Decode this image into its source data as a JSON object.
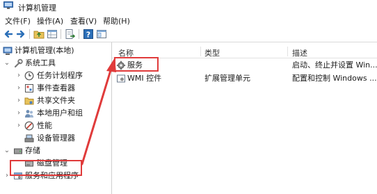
{
  "window": {
    "title": "计算机管理"
  },
  "menu": [
    "文件(F)",
    "操作(A)",
    "查看(V)",
    "帮助(H)"
  ],
  "toolbar": {
    "icons": [
      "back-arrow-icon",
      "forward-arrow-icon",
      "folder-up-icon",
      "properties-grid-icon",
      "export-list-icon",
      "help-icon",
      "console-tree-icon"
    ]
  },
  "tree": {
    "root": "计算机管理(本地)",
    "items": [
      {
        "label": "系统工具",
        "expanded": true
      },
      {
        "label": "任务计划程序"
      },
      {
        "label": "事件查看器"
      },
      {
        "label": "共享文件夹"
      },
      {
        "label": "本地用户和组"
      },
      {
        "label": "性能"
      },
      {
        "label": "设备管理器"
      },
      {
        "label": "存储",
        "expanded": true
      },
      {
        "label": "磁盘管理"
      },
      {
        "label": "服务和应用程序"
      }
    ]
  },
  "list": {
    "columns": [
      "名称",
      "类型",
      "描述"
    ],
    "rows": [
      {
        "name": "服务",
        "type": "",
        "desc": "启动、终止并设置 Win..."
      },
      {
        "name": "WMI 控件",
        "type": "扩展管理单元",
        "desc": "配置和控制 Windows ..."
      }
    ]
  },
  "annotation": {
    "color": "#e03b3b"
  }
}
